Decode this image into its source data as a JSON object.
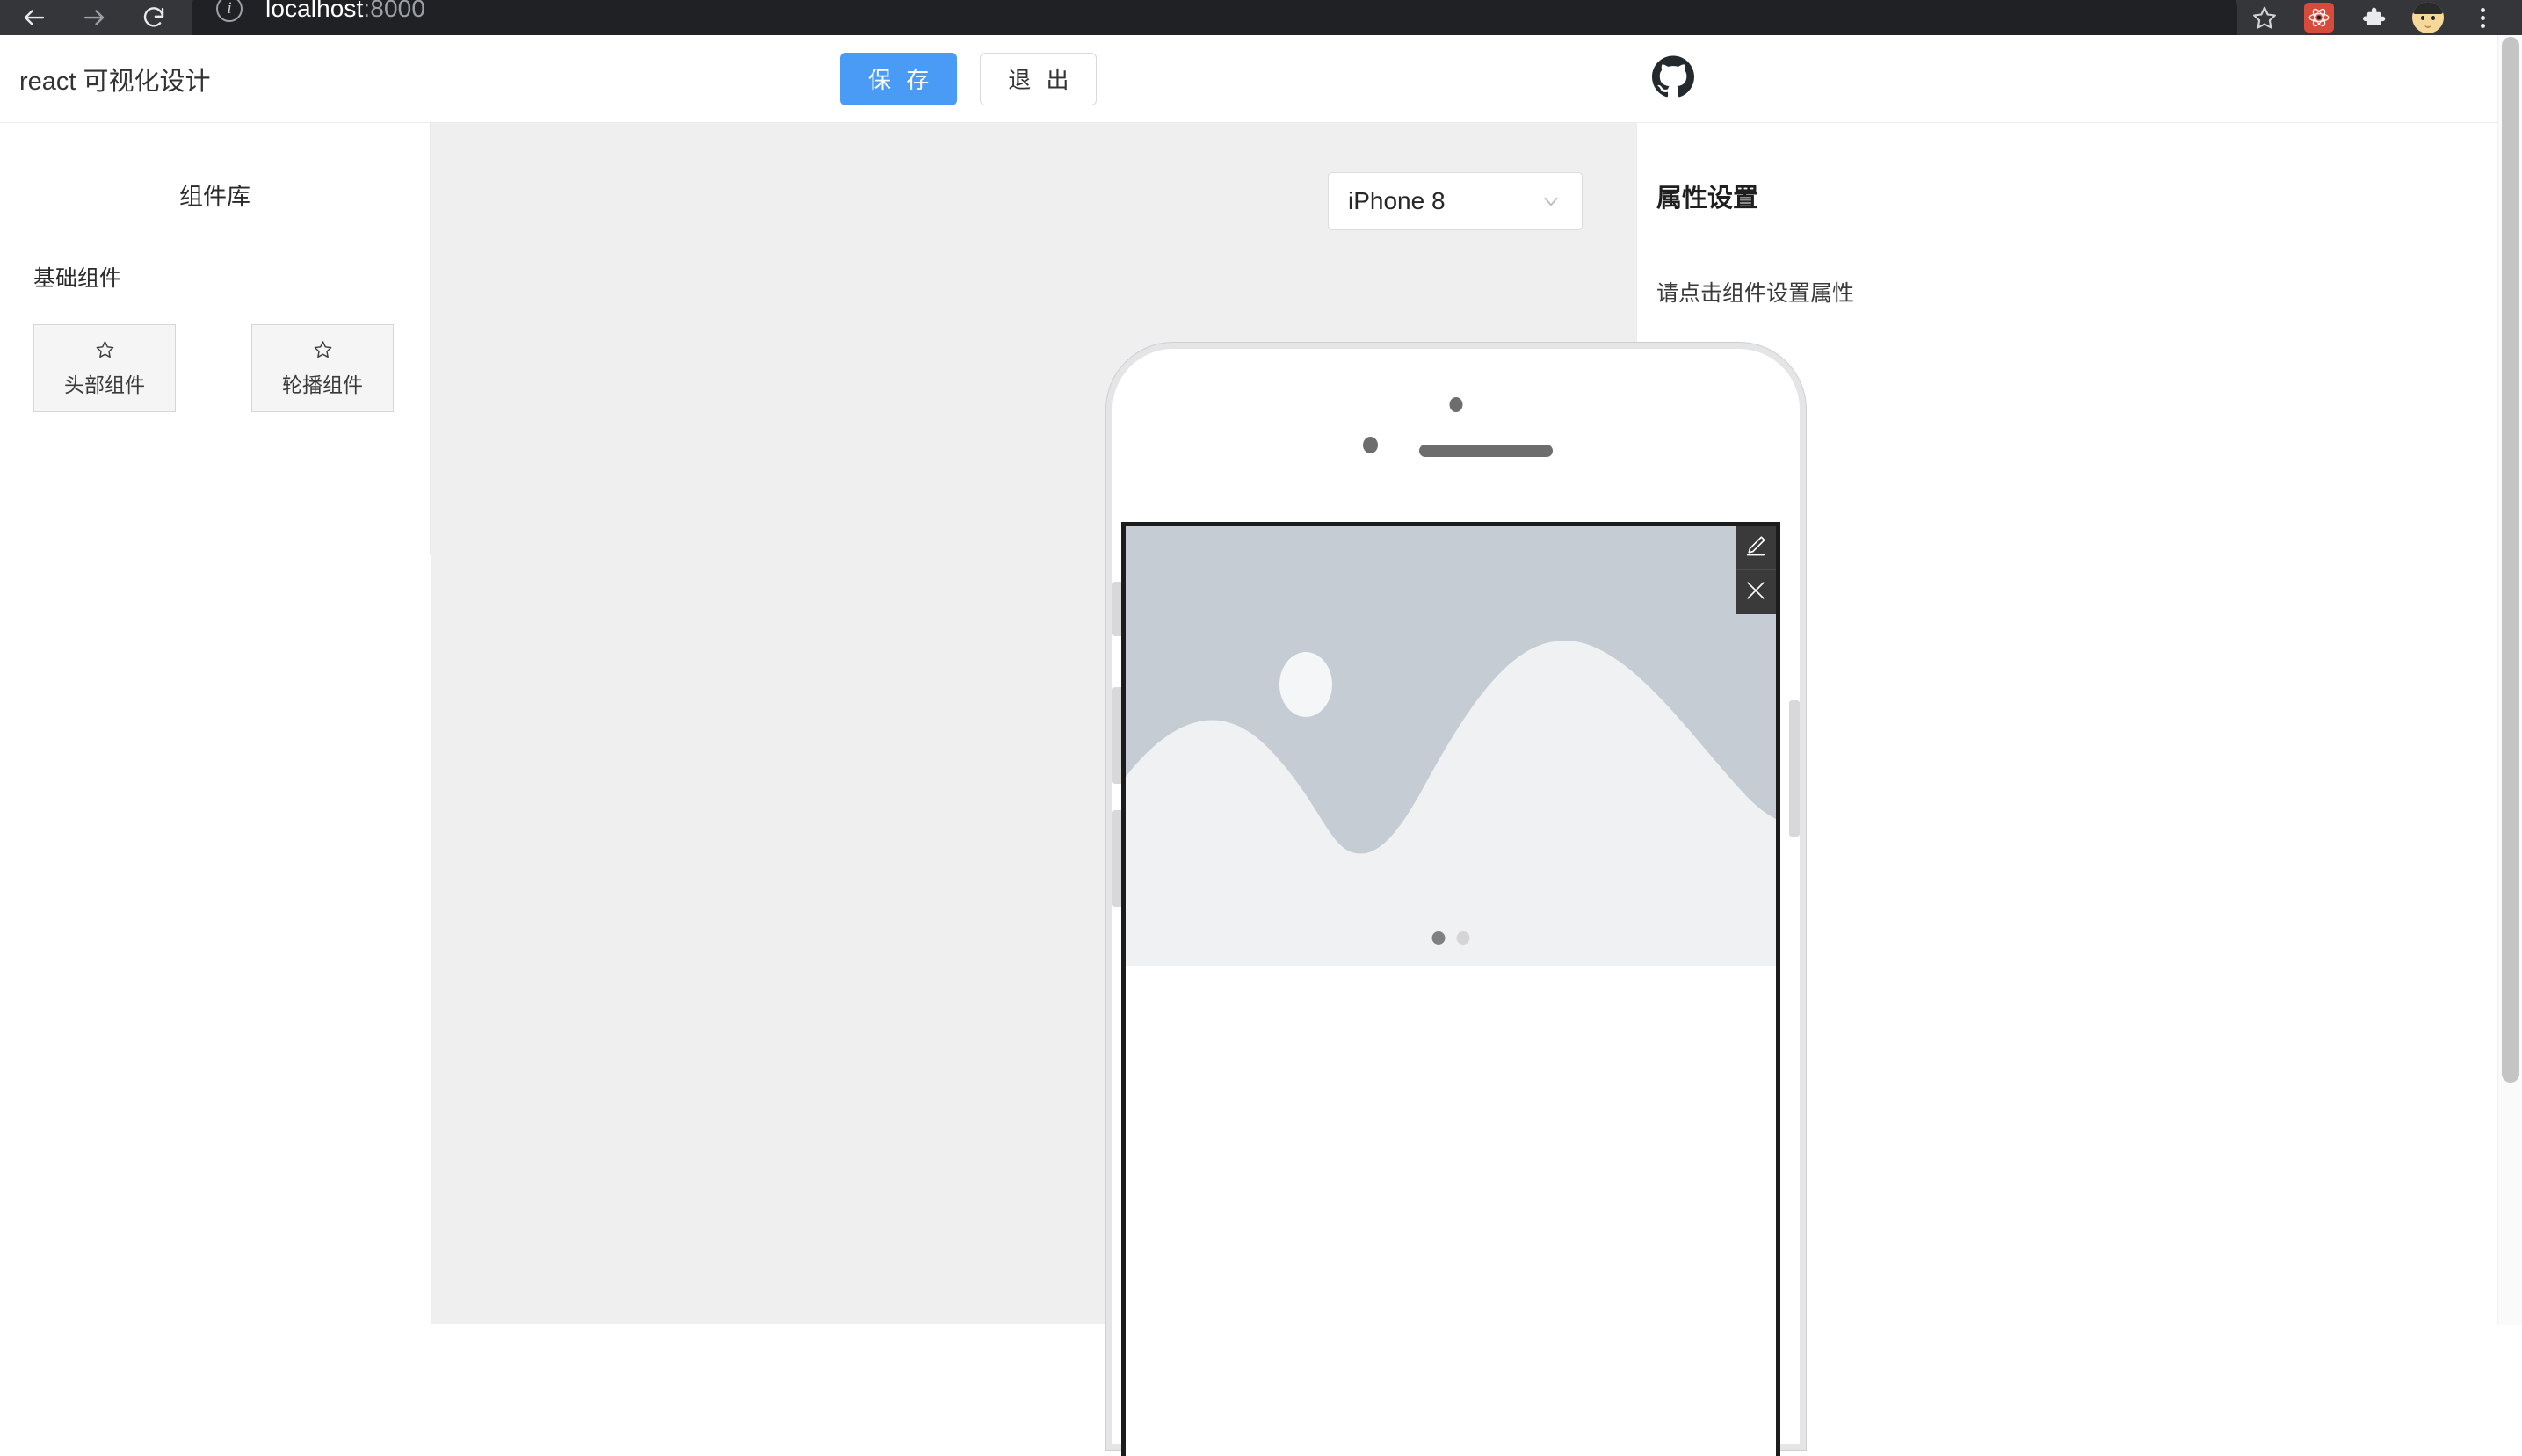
{
  "browser": {
    "back_icon": "arrow-left-icon",
    "forward_icon": "arrow-right-icon",
    "reload_icon": "reload-icon",
    "site_info_icon": "info-circle-icon",
    "url_host": "localhost",
    "url_port": ":8000",
    "bookmark_icon": "star-icon",
    "extension_react_icon": "react-devtools-icon",
    "extensions_icon": "puzzle-piece-icon",
    "profile_icon": "avatar-icon",
    "menu_icon": "three-dots-menu-icon"
  },
  "header": {
    "title": "react 可视化设计",
    "save_label": "保 存",
    "exit_label": "退 出",
    "github_icon": "github-icon"
  },
  "sidebar": {
    "title": "组件库",
    "section_label": "基础组件",
    "components": [
      {
        "label": "头部组件",
        "icon": "star-outline-icon"
      },
      {
        "label": "轮播组件",
        "icon": "star-outline-icon"
      }
    ]
  },
  "canvas": {
    "device_select": {
      "value": "iPhone 8",
      "chevron_icon": "chevron-down-icon"
    },
    "phone": {
      "camera_icon": "camera-dot",
      "sensor_icon": "sensor-dot",
      "speaker_icon": "speaker-grille"
    },
    "selected_widget": {
      "type": "carousel",
      "edit_icon": "pencil-edit-icon",
      "delete_icon": "close-x-icon",
      "dots": [
        {
          "active": true
        },
        {
          "active": false
        }
      ],
      "placeholder_colors": {
        "sky": "#c5ccd4",
        "hill": "#eff1f3",
        "sun": "#f4f6f8"
      }
    }
  },
  "properties": {
    "title": "属性设置",
    "hint": "请点击组件设置属性"
  },
  "colors": {
    "primary": "#4a9bf5",
    "selection": "#2f8ae0",
    "toolbar_dark": "#3a3a3a",
    "canvas_bg": "#efefef",
    "github": "#24292e"
  }
}
